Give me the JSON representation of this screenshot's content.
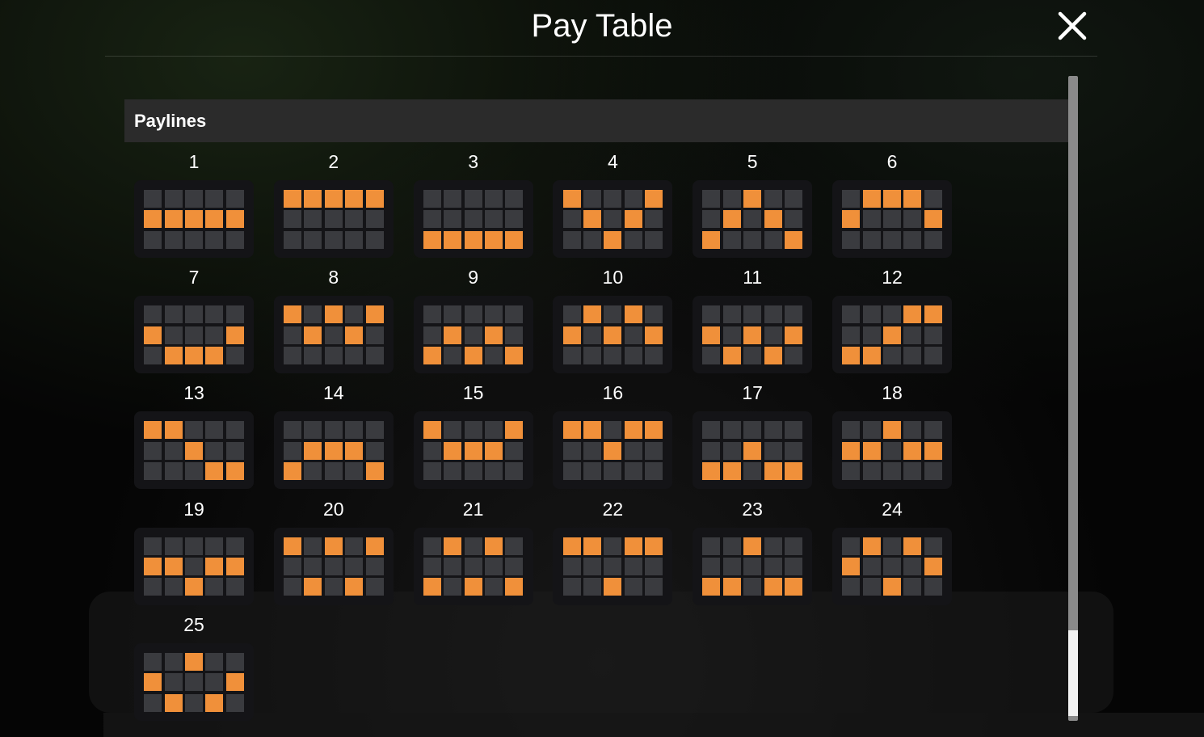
{
  "header": {
    "title": "Pay Table",
    "close_icon": "close-icon"
  },
  "section": {
    "title": "Paylines"
  },
  "colors": {
    "active_cell": "#f0903a",
    "inactive_cell": "#3a3b3f",
    "card_background": "#141417"
  },
  "paylines": [
    {
      "label": "1",
      "rows": [
        1,
        1,
        1,
        1,
        1
      ]
    },
    {
      "label": "2",
      "rows": [
        0,
        0,
        0,
        0,
        0
      ]
    },
    {
      "label": "3",
      "rows": [
        2,
        2,
        2,
        2,
        2
      ]
    },
    {
      "label": "4",
      "rows": [
        0,
        1,
        2,
        1,
        0
      ]
    },
    {
      "label": "5",
      "rows": [
        2,
        1,
        0,
        1,
        2
      ]
    },
    {
      "label": "6",
      "rows": [
        1,
        0,
        0,
        0,
        1
      ]
    },
    {
      "label": "7",
      "rows": [
        1,
        2,
        2,
        2,
        1
      ]
    },
    {
      "label": "8",
      "rows": [
        0,
        1,
        0,
        1,
        0
      ]
    },
    {
      "label": "9",
      "rows": [
        2,
        1,
        2,
        1,
        2
      ]
    },
    {
      "label": "10",
      "rows": [
        1,
        0,
        1,
        0,
        1
      ]
    },
    {
      "label": "11",
      "rows": [
        1,
        2,
        1,
        2,
        1
      ]
    },
    {
      "label": "12",
      "rows": [
        2,
        2,
        1,
        0,
        0
      ]
    },
    {
      "label": "13",
      "rows": [
        0,
        0,
        1,
        2,
        2
      ]
    },
    {
      "label": "14",
      "rows": [
        2,
        1,
        1,
        1,
        2
      ]
    },
    {
      "label": "15",
      "rows": [
        0,
        1,
        1,
        1,
        0
      ]
    },
    {
      "label": "16",
      "rows": [
        0,
        0,
        1,
        0,
        0
      ]
    },
    {
      "label": "17",
      "rows": [
        2,
        2,
        1,
        2,
        2
      ]
    },
    {
      "label": "18",
      "rows": [
        1,
        1,
        0,
        1,
        1
      ]
    },
    {
      "label": "19",
      "rows": [
        1,
        1,
        2,
        1,
        1
      ]
    },
    {
      "label": "20",
      "rows": [
        0,
        2,
        0,
        2,
        0
      ]
    },
    {
      "label": "21",
      "rows": [
        2,
        0,
        2,
        0,
        2
      ]
    },
    {
      "label": "22",
      "rows": [
        0,
        0,
        2,
        0,
        0
      ]
    },
    {
      "label": "23",
      "rows": [
        2,
        2,
        0,
        2,
        2
      ]
    },
    {
      "label": "24",
      "rows": [
        1,
        0,
        2,
        0,
        1
      ]
    },
    {
      "label": "25",
      "rows": [
        1,
        2,
        0,
        2,
        1
      ]
    }
  ]
}
